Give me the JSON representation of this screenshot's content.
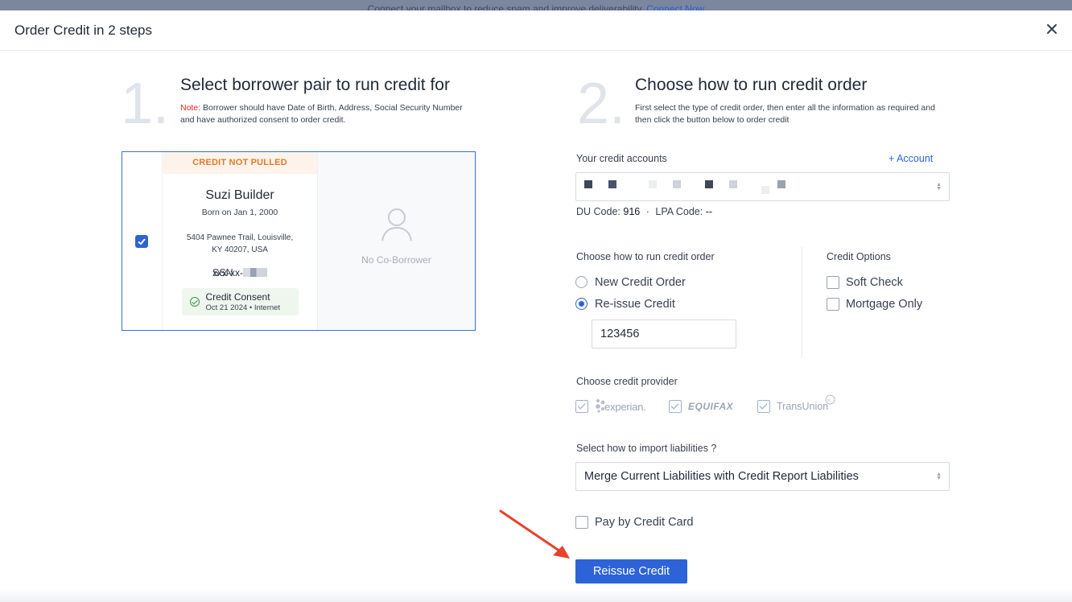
{
  "banner": {
    "text": "Connect your mailbox to reduce spam and improve deliverability.",
    "link": "Connect Now"
  },
  "modal": {
    "title": "Order Credit in 2 steps"
  },
  "step1": {
    "number": "1.",
    "title": "Select borrower pair to run credit for",
    "note_label": "Note:",
    "note_text": "Borrower should have Date of Birth, Address, Social Security Number and have authorized consent to order credit.",
    "card": {
      "status": "CREDIT NOT PULLED",
      "name": "Suzi Builder",
      "born": "Born on Jan 1, 2000",
      "address_line1": "5404 Pawnee Trail, Louisville,",
      "address_line2": "KY 40207, USA",
      "ssn_label": "SSN",
      "ssn_value": "xxx-xx-",
      "consent_title": "Credit Consent",
      "consent_sub": "Oct 21 2024 • Internet",
      "no_coborrower": "No Co-Borrower",
      "selected": true
    }
  },
  "step2": {
    "number": "2.",
    "title": "Choose how to run credit order",
    "desc": "First select the type of credit order, then enter all the information as required and then click the button below to order credit",
    "accounts_label": "Your credit accounts",
    "add_account": "+ Account",
    "du_label": "DU Code:",
    "du_value": "916",
    "lpa_label": "LPA Code:",
    "lpa_value": "--",
    "run_label": "Choose how to run credit order",
    "options": [
      "New Credit Order",
      "Re-issue Credit"
    ],
    "selected_option": "Re-issue Credit",
    "reissue_value": "123456",
    "credit_options_label": "Credit Options",
    "credit_options": [
      "Soft Check",
      "Mortgage Only"
    ],
    "provider_label": "Choose credit provider",
    "providers": [
      "experian.",
      "EQUIFAX",
      "TransUnion"
    ],
    "liabilities_label": "Select how to import liabilities ?",
    "liabilities_value": "Merge Current Liabilities with Credit Report Liabilities",
    "pay_card_label": "Pay by Credit Card",
    "submit_label": "Reissue Credit"
  },
  "colors": {
    "accent": "#2d63d8",
    "warning": "#e07b28",
    "note": "#dc2626"
  }
}
